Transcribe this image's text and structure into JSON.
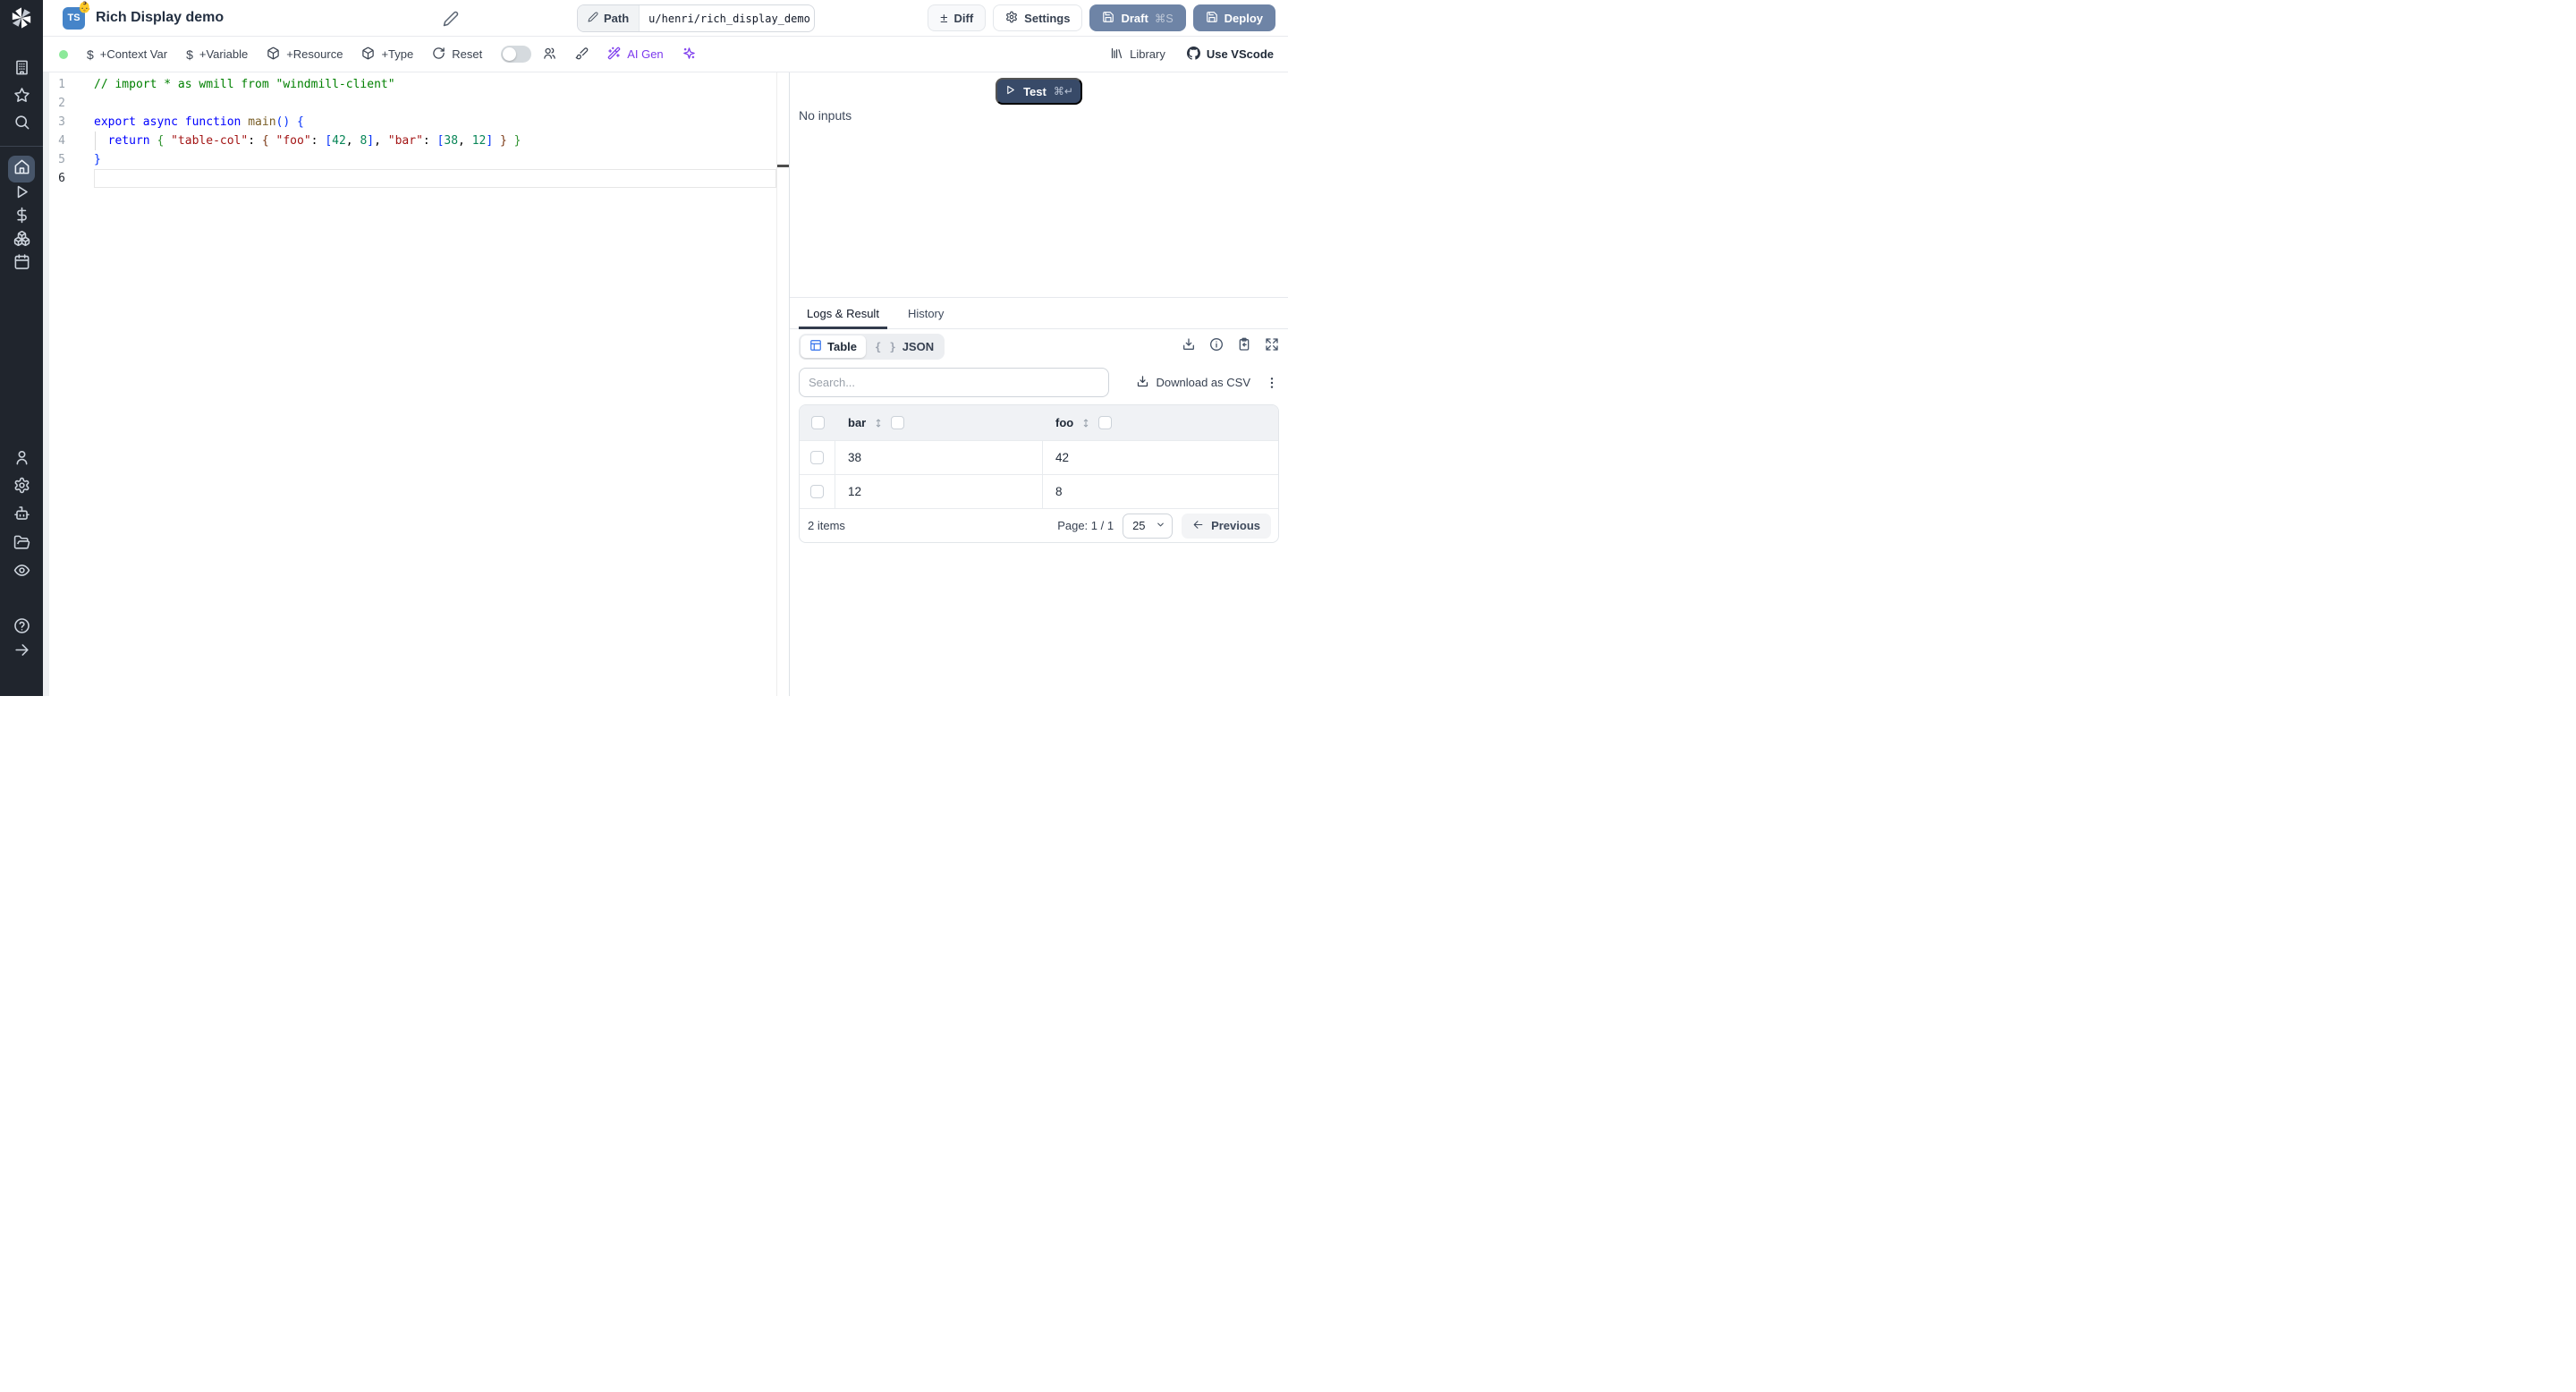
{
  "header": {
    "title": "Rich Display demo",
    "language_badge": "TS",
    "badge_emoji": "👶",
    "path": {
      "label": "Path",
      "value": "u/henri/rich_display_demo"
    },
    "buttons": {
      "diff": "Diff",
      "diff_glyph": "±",
      "settings": "Settings",
      "draft": "Draft",
      "draft_shortcut": "⌘S",
      "deploy": "Deploy"
    }
  },
  "toolbar": {
    "add_context_var": "+Context Var",
    "add_variable": "+Variable",
    "add_resource": "+Resource",
    "add_type": "+Type",
    "reset": "Reset",
    "dollar_glyph": "$",
    "ai_gen": "AI Gen",
    "library": "Library",
    "use_vscode": "Use VScode"
  },
  "editor": {
    "lines": [
      {
        "tokens": [
          [
            "cm",
            "// import * as wmill from \"windmill-client\""
          ]
        ]
      },
      {
        "tokens": []
      },
      {
        "tokens": [
          [
            "kw",
            "export"
          ],
          [
            "pl",
            " "
          ],
          [
            "kw",
            "async"
          ],
          [
            "pl",
            " "
          ],
          [
            "kw",
            "function"
          ],
          [
            "pl",
            " "
          ],
          [
            "fn",
            "main"
          ],
          [
            "b1",
            "()"
          ],
          [
            "pl",
            " "
          ],
          [
            "b1",
            "{"
          ]
        ]
      },
      {
        "tokens": [
          [
            "pl",
            "  "
          ],
          [
            "kw",
            "return"
          ],
          [
            "pl",
            " "
          ],
          [
            "b2",
            "{"
          ],
          [
            "pl",
            " "
          ],
          [
            "str",
            "\"table-col\""
          ],
          [
            "pl",
            ": "
          ],
          [
            "b3",
            "{"
          ],
          [
            "pl",
            " "
          ],
          [
            "str",
            "\"foo\""
          ],
          [
            "pl",
            ": "
          ],
          [
            "b1",
            "["
          ],
          [
            "num",
            "42"
          ],
          [
            "pl",
            ", "
          ],
          [
            "num",
            "8"
          ],
          [
            "b1",
            "]"
          ],
          [
            "pl",
            ", "
          ],
          [
            "str",
            "\"bar\""
          ],
          [
            "pl",
            ": "
          ],
          [
            "b1",
            "["
          ],
          [
            "num",
            "38"
          ],
          [
            "pl",
            ", "
          ],
          [
            "num",
            "12"
          ],
          [
            "b1",
            "]"
          ],
          [
            "pl",
            " "
          ],
          [
            "b3",
            "}"
          ],
          [
            "pl",
            " "
          ],
          [
            "b2",
            "}"
          ]
        ],
        "indent_guide": true
      },
      {
        "tokens": [
          [
            "b1",
            "}"
          ]
        ]
      },
      {
        "tokens": [],
        "active": true
      }
    ],
    "token_colors": {
      "cm": "#008000",
      "kw": "#0000ff",
      "fn": "#795e26",
      "str": "#a31515",
      "num": "#098658",
      "b1": "#0431fa",
      "b2": "#319331",
      "b3": "#7b3814",
      "pl": "#000000"
    }
  },
  "run_panel": {
    "test_label": "Test",
    "test_shortcut": "⌘↵",
    "no_inputs": "No inputs"
  },
  "results": {
    "tabs": {
      "logs": "Logs & Result",
      "history": "History"
    },
    "view_modes": {
      "table": "Table",
      "json": "JSON",
      "json_icon": "{ }"
    },
    "search_placeholder": "Search...",
    "download_csv": "Download as CSV",
    "table": {
      "columns": [
        "bar",
        "foo"
      ],
      "rows": [
        [
          "38",
          "42"
        ],
        [
          "12",
          "8"
        ]
      ],
      "items_count": "2 items",
      "page_label": "Page: 1 / 1",
      "page_size": "25",
      "previous_label": "Previous"
    }
  },
  "sidebar_icons": [
    "windmill-logo",
    "buildings",
    "star",
    "search",
    "home",
    "play",
    "dollar",
    "boxes",
    "calendar",
    "user",
    "settings",
    "robot",
    "folder-open",
    "eye",
    "help-circle",
    "arrow-right"
  ],
  "colors": {
    "sidebar_bg": "#20252d",
    "active_nav_bg": "#475569",
    "primary_button_bg": "#6e84a6",
    "test_button_bg": "#384a68",
    "ts_badge_bg": "#4584c9",
    "ai_purple": "#7c3aed",
    "green_status_dot": "#8ce99a",
    "table_header_bg": "#f0f2f5"
  }
}
